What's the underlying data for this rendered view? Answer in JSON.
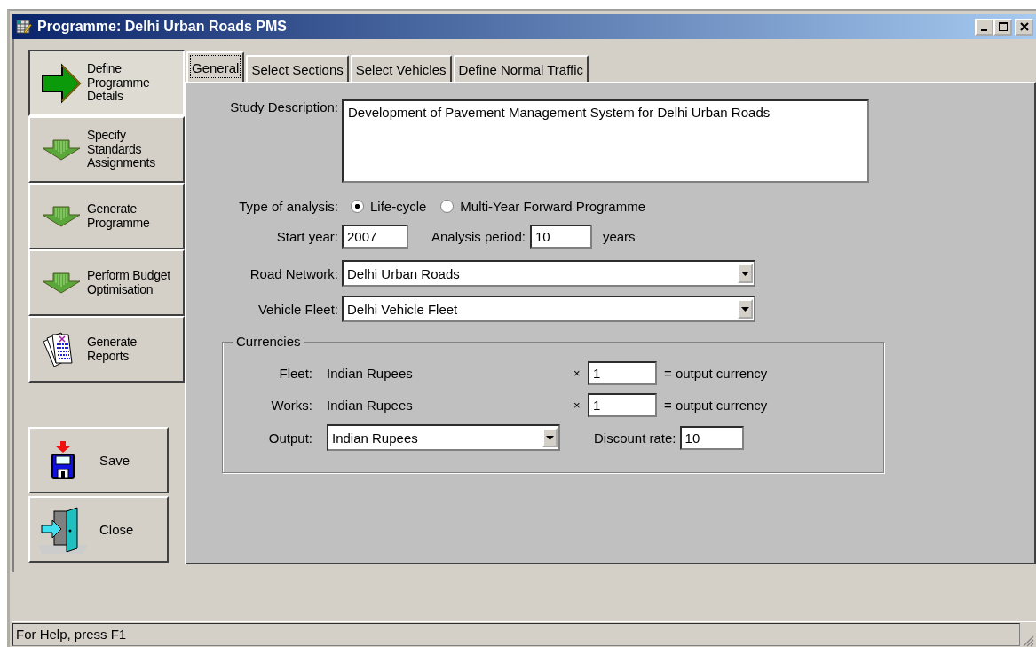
{
  "window": {
    "title": "Programme: Delhi Urban Roads PMS"
  },
  "steps": [
    {
      "label": "Define Programme Details",
      "kind": "arrow-right",
      "selected": true
    },
    {
      "label": "Specify Standards Assignments",
      "kind": "arrow-down",
      "selected": false
    },
    {
      "label": "Generate Programme",
      "kind": "arrow-down",
      "selected": false
    },
    {
      "label": "Perform Budget Optimisation",
      "kind": "arrow-down",
      "selected": false
    },
    {
      "label": "Generate Reports",
      "kind": "reports",
      "selected": false
    }
  ],
  "actions": [
    {
      "label": "Save",
      "kind": "save"
    },
    {
      "label": "Close",
      "kind": "close"
    }
  ],
  "tabs": [
    {
      "label": "General",
      "selected": true
    },
    {
      "label": "Select Sections",
      "selected": false
    },
    {
      "label": "Select Vehicles",
      "selected": false
    },
    {
      "label": "Define Normal Traffic",
      "selected": false
    }
  ],
  "general": {
    "study_description": {
      "label": "Study Description:",
      "value": "Development of Pavement Management System for Delhi Urban Roads"
    },
    "analysis_type": {
      "label": "Type of analysis:",
      "options": [
        {
          "label": "Life-cycle",
          "selected": true
        },
        {
          "label": "Multi-Year Forward Programme",
          "selected": false
        }
      ]
    },
    "start_year": {
      "label": "Start year:",
      "value": "2007"
    },
    "analysis_period": {
      "label": "Analysis period:",
      "value": "10",
      "unit": "years"
    },
    "road_network": {
      "label": "Road Network:",
      "value": "Delhi Urban Roads"
    },
    "vehicle_fleet": {
      "label": "Vehicle Fleet:",
      "value": "Delhi Vehicle Fleet"
    },
    "currencies": {
      "title": "Currencies",
      "rows": [
        {
          "label": "Fleet:",
          "currency": "Indian Rupees",
          "times": "×",
          "factor": "1",
          "result": "= output currency"
        },
        {
          "label": "Works:",
          "currency": "Indian Rupees",
          "times": "×",
          "factor": "1",
          "result": "= output currency"
        }
      ],
      "output": {
        "label": "Output:",
        "value": "Indian Rupees"
      },
      "discount_rate": {
        "label": "Discount rate:",
        "value": "10"
      }
    }
  },
  "status_bar": {
    "text": "For Help, press F1"
  }
}
